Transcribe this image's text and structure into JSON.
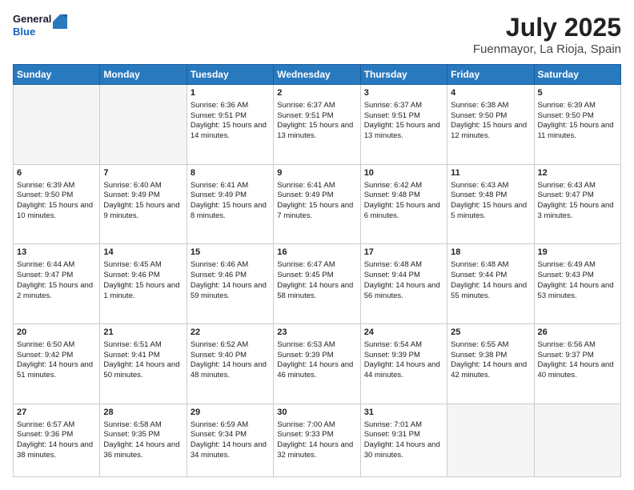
{
  "header": {
    "logo_line1": "General",
    "logo_line2": "Blue",
    "title": "July 2025",
    "subtitle": "Fuenmayor, La Rioja, Spain"
  },
  "days_of_week": [
    "Sunday",
    "Monday",
    "Tuesday",
    "Wednesday",
    "Thursday",
    "Friday",
    "Saturday"
  ],
  "weeks": [
    [
      {
        "day": "",
        "sunrise": "",
        "sunset": "",
        "daylight": "",
        "empty": true
      },
      {
        "day": "",
        "sunrise": "",
        "sunset": "",
        "daylight": "",
        "empty": true
      },
      {
        "day": "1",
        "sunrise": "Sunrise: 6:36 AM",
        "sunset": "Sunset: 9:51 PM",
        "daylight": "Daylight: 15 hours and 14 minutes.",
        "empty": false
      },
      {
        "day": "2",
        "sunrise": "Sunrise: 6:37 AM",
        "sunset": "Sunset: 9:51 PM",
        "daylight": "Daylight: 15 hours and 13 minutes.",
        "empty": false
      },
      {
        "day": "3",
        "sunrise": "Sunrise: 6:37 AM",
        "sunset": "Sunset: 9:51 PM",
        "daylight": "Daylight: 15 hours and 13 minutes.",
        "empty": false
      },
      {
        "day": "4",
        "sunrise": "Sunrise: 6:38 AM",
        "sunset": "Sunset: 9:50 PM",
        "daylight": "Daylight: 15 hours and 12 minutes.",
        "empty": false
      },
      {
        "day": "5",
        "sunrise": "Sunrise: 6:39 AM",
        "sunset": "Sunset: 9:50 PM",
        "daylight": "Daylight: 15 hours and 11 minutes.",
        "empty": false
      }
    ],
    [
      {
        "day": "6",
        "sunrise": "Sunrise: 6:39 AM",
        "sunset": "Sunset: 9:50 PM",
        "daylight": "Daylight: 15 hours and 10 minutes.",
        "empty": false
      },
      {
        "day": "7",
        "sunrise": "Sunrise: 6:40 AM",
        "sunset": "Sunset: 9:49 PM",
        "daylight": "Daylight: 15 hours and 9 minutes.",
        "empty": false
      },
      {
        "day": "8",
        "sunrise": "Sunrise: 6:41 AM",
        "sunset": "Sunset: 9:49 PM",
        "daylight": "Daylight: 15 hours and 8 minutes.",
        "empty": false
      },
      {
        "day": "9",
        "sunrise": "Sunrise: 6:41 AM",
        "sunset": "Sunset: 9:49 PM",
        "daylight": "Daylight: 15 hours and 7 minutes.",
        "empty": false
      },
      {
        "day": "10",
        "sunrise": "Sunrise: 6:42 AM",
        "sunset": "Sunset: 9:48 PM",
        "daylight": "Daylight: 15 hours and 6 minutes.",
        "empty": false
      },
      {
        "day": "11",
        "sunrise": "Sunrise: 6:43 AM",
        "sunset": "Sunset: 9:48 PM",
        "daylight": "Daylight: 15 hours and 5 minutes.",
        "empty": false
      },
      {
        "day": "12",
        "sunrise": "Sunrise: 6:43 AM",
        "sunset": "Sunset: 9:47 PM",
        "daylight": "Daylight: 15 hours and 3 minutes.",
        "empty": false
      }
    ],
    [
      {
        "day": "13",
        "sunrise": "Sunrise: 6:44 AM",
        "sunset": "Sunset: 9:47 PM",
        "daylight": "Daylight: 15 hours and 2 minutes.",
        "empty": false
      },
      {
        "day": "14",
        "sunrise": "Sunrise: 6:45 AM",
        "sunset": "Sunset: 9:46 PM",
        "daylight": "Daylight: 15 hours and 1 minute.",
        "empty": false
      },
      {
        "day": "15",
        "sunrise": "Sunrise: 6:46 AM",
        "sunset": "Sunset: 9:46 PM",
        "daylight": "Daylight: 14 hours and 59 minutes.",
        "empty": false
      },
      {
        "day": "16",
        "sunrise": "Sunrise: 6:47 AM",
        "sunset": "Sunset: 9:45 PM",
        "daylight": "Daylight: 14 hours and 58 minutes.",
        "empty": false
      },
      {
        "day": "17",
        "sunrise": "Sunrise: 6:48 AM",
        "sunset": "Sunset: 9:44 PM",
        "daylight": "Daylight: 14 hours and 56 minutes.",
        "empty": false
      },
      {
        "day": "18",
        "sunrise": "Sunrise: 6:48 AM",
        "sunset": "Sunset: 9:44 PM",
        "daylight": "Daylight: 14 hours and 55 minutes.",
        "empty": false
      },
      {
        "day": "19",
        "sunrise": "Sunrise: 6:49 AM",
        "sunset": "Sunset: 9:43 PM",
        "daylight": "Daylight: 14 hours and 53 minutes.",
        "empty": false
      }
    ],
    [
      {
        "day": "20",
        "sunrise": "Sunrise: 6:50 AM",
        "sunset": "Sunset: 9:42 PM",
        "daylight": "Daylight: 14 hours and 51 minutes.",
        "empty": false
      },
      {
        "day": "21",
        "sunrise": "Sunrise: 6:51 AM",
        "sunset": "Sunset: 9:41 PM",
        "daylight": "Daylight: 14 hours and 50 minutes.",
        "empty": false
      },
      {
        "day": "22",
        "sunrise": "Sunrise: 6:52 AM",
        "sunset": "Sunset: 9:40 PM",
        "daylight": "Daylight: 14 hours and 48 minutes.",
        "empty": false
      },
      {
        "day": "23",
        "sunrise": "Sunrise: 6:53 AM",
        "sunset": "Sunset: 9:39 PM",
        "daylight": "Daylight: 14 hours and 46 minutes.",
        "empty": false
      },
      {
        "day": "24",
        "sunrise": "Sunrise: 6:54 AM",
        "sunset": "Sunset: 9:39 PM",
        "daylight": "Daylight: 14 hours and 44 minutes.",
        "empty": false
      },
      {
        "day": "25",
        "sunrise": "Sunrise: 6:55 AM",
        "sunset": "Sunset: 9:38 PM",
        "daylight": "Daylight: 14 hours and 42 minutes.",
        "empty": false
      },
      {
        "day": "26",
        "sunrise": "Sunrise: 6:56 AM",
        "sunset": "Sunset: 9:37 PM",
        "daylight": "Daylight: 14 hours and 40 minutes.",
        "empty": false
      }
    ],
    [
      {
        "day": "27",
        "sunrise": "Sunrise: 6:57 AM",
        "sunset": "Sunset: 9:36 PM",
        "daylight": "Daylight: 14 hours and 38 minutes.",
        "empty": false
      },
      {
        "day": "28",
        "sunrise": "Sunrise: 6:58 AM",
        "sunset": "Sunset: 9:35 PM",
        "daylight": "Daylight: 14 hours and 36 minutes.",
        "empty": false
      },
      {
        "day": "29",
        "sunrise": "Sunrise: 6:59 AM",
        "sunset": "Sunset: 9:34 PM",
        "daylight": "Daylight: 14 hours and 34 minutes.",
        "empty": false
      },
      {
        "day": "30",
        "sunrise": "Sunrise: 7:00 AM",
        "sunset": "Sunset: 9:33 PM",
        "daylight": "Daylight: 14 hours and 32 minutes.",
        "empty": false
      },
      {
        "day": "31",
        "sunrise": "Sunrise: 7:01 AM",
        "sunset": "Sunset: 9:31 PM",
        "daylight": "Daylight: 14 hours and 30 minutes.",
        "empty": false
      },
      {
        "day": "",
        "sunrise": "",
        "sunset": "",
        "daylight": "",
        "empty": true
      },
      {
        "day": "",
        "sunrise": "",
        "sunset": "",
        "daylight": "",
        "empty": true
      }
    ]
  ]
}
